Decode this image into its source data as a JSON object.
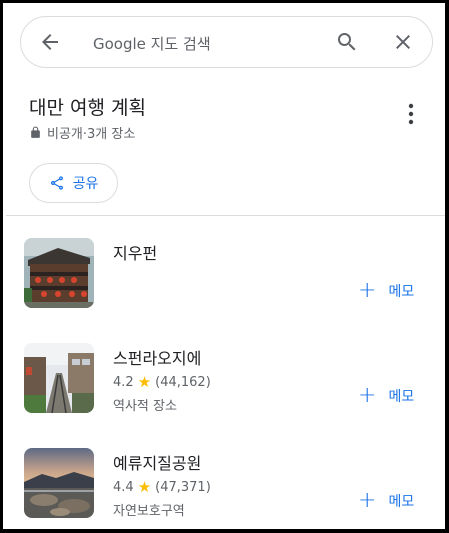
{
  "search": {
    "placeholder": "Google 지도 검색"
  },
  "list": {
    "title": "대만 여행 계획",
    "visibility": "비공개·3개 장소",
    "share_label": "공유"
  },
  "places": [
    {
      "name": "지우펀",
      "rating": "",
      "reviews": "",
      "category": "",
      "memo_label": "메모"
    },
    {
      "name": "스펀라오지에",
      "rating": "4.2",
      "reviews": "(44,162)",
      "category": "역사적 장소",
      "memo_label": "메모"
    },
    {
      "name": "예류지질공원",
      "rating": "4.4",
      "reviews": "(47,371)",
      "category": "자연보호구역",
      "memo_label": "메모"
    }
  ],
  "icons": {
    "back": "arrow-back-icon",
    "search": "search-icon",
    "close": "close-icon",
    "more": "more-vert-icon",
    "lock": "lock-icon",
    "share": "share-icon",
    "star": "star-icon"
  },
  "colors": {
    "accent": "#1a73e8",
    "star": "#fbbc04",
    "text": "#202124",
    "secondary": "#5f6368"
  }
}
